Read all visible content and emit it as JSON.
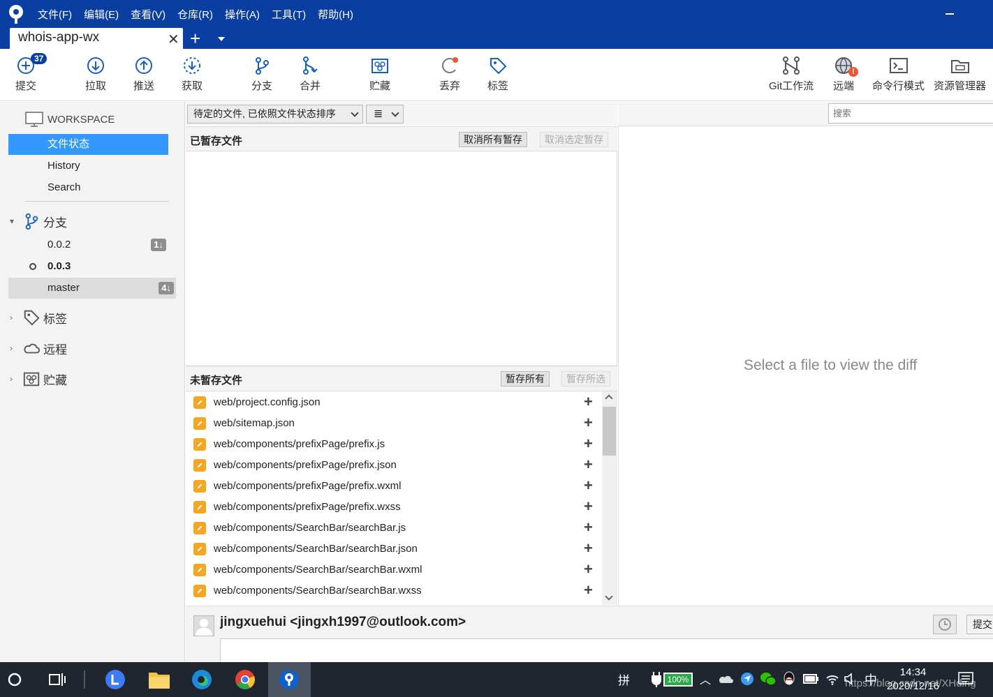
{
  "titlebar": {
    "menu": [
      "文件(F)",
      "编辑(E)",
      "查看(V)",
      "仓库(R)",
      "操作(A)",
      "工具(T)",
      "帮助(H)"
    ]
  },
  "tab": {
    "title": "whois-app-wx",
    "close": "✕",
    "new": "+"
  },
  "toolbar": {
    "commit": {
      "label": "提交",
      "badge": "37"
    },
    "pull": "拉取",
    "push": "推送",
    "fetch": "获取",
    "branch": "分支",
    "merge": "合并",
    "stash": "贮藏",
    "discard": "丢弃",
    "tag": "标签",
    "gitflow": "Git工作流",
    "remote": "远端",
    "terminal": "命令行模式",
    "explorer": "资源管理器"
  },
  "sidebar": {
    "workspace": "WORKSPACE",
    "workspace_items": [
      "文件状态",
      "History",
      "Search"
    ],
    "branches_label": "分支",
    "branches": [
      {
        "name": "0.0.2",
        "count": "1↓"
      },
      {
        "name": "0.0.3",
        "count": ""
      },
      {
        "name": "master",
        "count": "4↓"
      }
    ],
    "tags_label": "标签",
    "remotes_label": "远程",
    "stashes_label": "贮藏"
  },
  "filter": {
    "sort": "待定的文件, 已依照文件状态排序",
    "view": "≣"
  },
  "staged": {
    "title": "已暂存文件",
    "unstage_all": "取消所有暂存",
    "unstage_selected": "取消选定暂存"
  },
  "unstaged": {
    "title": "未暂存文件",
    "stage_all": "暂存所有",
    "stage_selected": "暂存所选",
    "files": [
      "web/project.config.json",
      "web/sitemap.json",
      "web/components/prefixPage/prefix.js",
      "web/components/prefixPage/prefix.json",
      "web/components/prefixPage/prefix.wxml",
      "web/components/prefixPage/prefix.wxss",
      "web/components/SearchBar/searchBar.js",
      "web/components/SearchBar/searchBar.json",
      "web/components/SearchBar/searchBar.wxml",
      "web/components/SearchBar/searchBar.wxss"
    ]
  },
  "search": {
    "placeholder": "搜索"
  },
  "diff": {
    "empty": "Select a file to view the diff"
  },
  "commit": {
    "author": "jingxuehui <jingxh1997@outlook.com>",
    "button": "提交"
  },
  "taskbar": {
    "ime": "拼",
    "battery": "100%",
    "lang": "中",
    "time": "14:34",
    "date": "2020/12/16",
    "watermark": "https://blog.csdn.net/XHding"
  },
  "colors": {
    "titlebar": "#0a3ea0",
    "selection": "#3399ff",
    "modified": "#f5a623"
  }
}
